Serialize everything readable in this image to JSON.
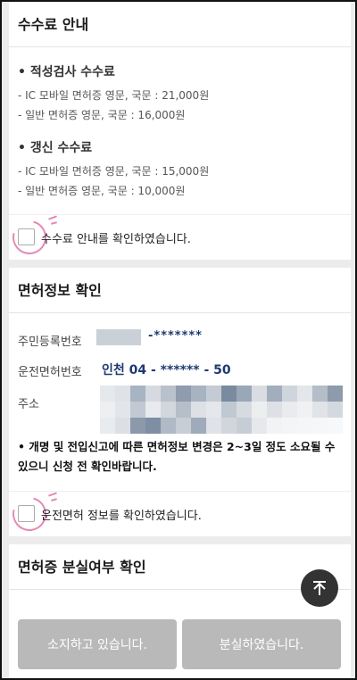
{
  "fee_section": {
    "title": "수수료 안내",
    "aptitude": {
      "heading": "• 적성검사 수수료",
      "lines": [
        "- IC 모바일 면허증 영문, 국문 : 21,000원",
        "- 일반 면허증 영문, 국문 : 16,000원"
      ]
    },
    "renewal": {
      "heading": "• 갱신 수수료",
      "lines": [
        "- IC 모바일 면허증 영문, 국문 : 15,000원",
        "- 일반 면허증 영문, 국문 : 10,000원"
      ]
    },
    "confirm_label": "수수료 안내를 확인하였습니다."
  },
  "license_section": {
    "title": "면허정보 확인",
    "resident_label": "주민등록번호",
    "resident_value": "-*******",
    "license_label": "운전면허번호",
    "license_value": "인천 04 - ****** - 50",
    "address_label": "주소",
    "notice": "• 개명 및 전입신고에 따른 면허정보 변경은 2~3일 정도 소요될 수 있으니 신청 전 확인바랍니다.",
    "confirm_label": "운전면허 정보를 확인하였습니다."
  },
  "loss_section": {
    "title": "면허증 분실여부 확인"
  },
  "buttons": {
    "have": "소지하고 있습니다.",
    "lost": "분실하였습니다."
  },
  "icons": {
    "scroll_top": "arrow-up-icon"
  },
  "colors": {
    "value_text": "#1f3a72",
    "button_disabled": "#b9b9b9",
    "highlight": "#e589b7"
  }
}
